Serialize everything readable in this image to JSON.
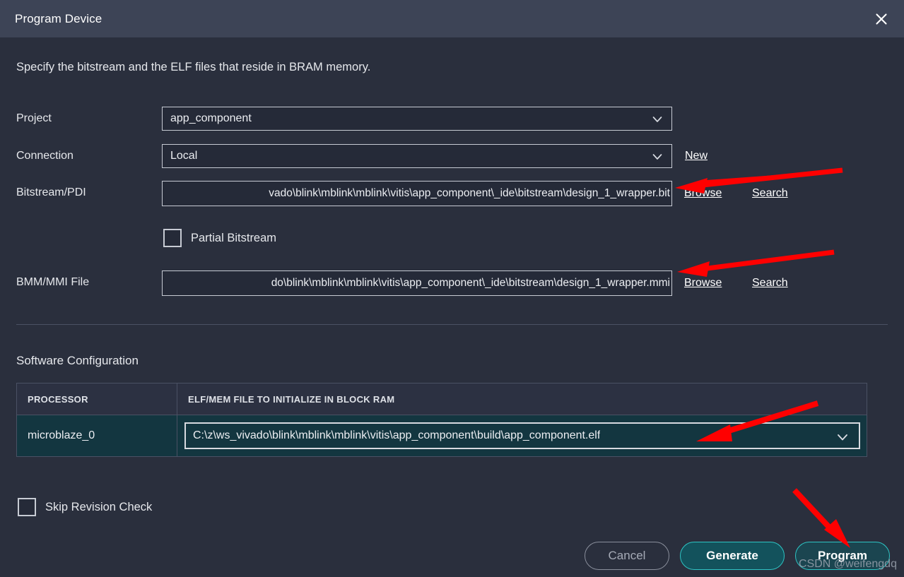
{
  "window": {
    "title": "Program Device",
    "close_icon": "close-icon"
  },
  "intro": "Specify the bitstream and the ELF files that reside in BRAM memory.",
  "fields": {
    "project": {
      "label": "Project",
      "value": "app_component",
      "icon": "chevron-down-icon"
    },
    "connection": {
      "label": "Connection",
      "value": "Local",
      "icon": "chevron-down-icon",
      "new_link": "New"
    },
    "bitstream": {
      "label": "Bitstream/PDI",
      "value": "vado\\blink\\mblink\\mblink\\vitis\\app_component\\_ide\\bitstream\\design_1_wrapper.bit",
      "browse": "Browse",
      "search": "Search"
    },
    "partial_bitstream": {
      "label": "Partial Bitstream",
      "checked": false
    },
    "bmm_mmi": {
      "label": "BMM/MMI File",
      "value": "do\\blink\\mblink\\mblink\\vitis\\app_component\\_ide\\bitstream\\design_1_wrapper.mmi",
      "browse": "Browse",
      "search": "Search"
    }
  },
  "software_configuration": {
    "title": "Software Configuration",
    "columns": [
      "PROCESSOR",
      "ELF/MEM FILE TO INITIALIZE IN BLOCK RAM"
    ],
    "rows": [
      {
        "processor": "microblaze_0",
        "elf_file": "C:\\z\\ws_vivado\\blink\\mblink\\mblink\\vitis\\app_component\\build\\app_component.elf",
        "icon": "chevron-down-icon"
      }
    ]
  },
  "skip_revision_check": {
    "label": "Skip Revision Check",
    "checked": false
  },
  "footer": {
    "cancel": "Cancel",
    "generate": "Generate",
    "program": "Program"
  },
  "watermark": "CSDN @weifengdq",
  "colors": {
    "titlebar": "#3d4456",
    "background": "#2a2f3d",
    "field_bg": "#252a38",
    "field_border": "#c7cbd4",
    "row_highlight": "#133640",
    "accent": "#2ec4c4",
    "annotation": "#ff0000",
    "text": "#e8eaed"
  },
  "annotations": [
    {
      "name": "arrow-to-bitstream-field",
      "color": "#ff0000"
    },
    {
      "name": "arrow-to-bmm-field",
      "color": "#ff0000"
    },
    {
      "name": "arrow-to-elf-field",
      "color": "#ff0000"
    },
    {
      "name": "arrow-to-program-button",
      "color": "#ff0000"
    }
  ]
}
